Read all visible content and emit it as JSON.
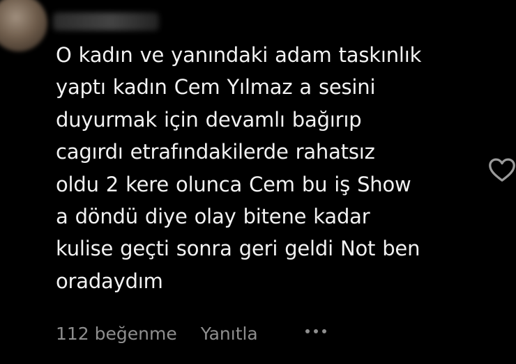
{
  "comment": {
    "lines": [
      "O kadın ve yanındaki adam taskınlık",
      "yaptı kadın Cem Yılmaz a sesini",
      "duyurmak için devamlı bağırıp",
      "cagırdı etrafındakilerde rahatsız",
      "oldu 2 kere olunca Cem bu iş Show",
      "a döndü diye olay bitene kadar",
      "kulise geçti sonra geri geldi Not ben",
      "oradaydım"
    ],
    "likes_label": "112 beğenme",
    "reply_label": "Yanıtla",
    "more_icon": "more-options-icon",
    "like_icon": "heart-outline-icon"
  },
  "colors": {
    "background": "#000000",
    "text": "#f2f2f2",
    "meta": "#8e8e8e"
  }
}
